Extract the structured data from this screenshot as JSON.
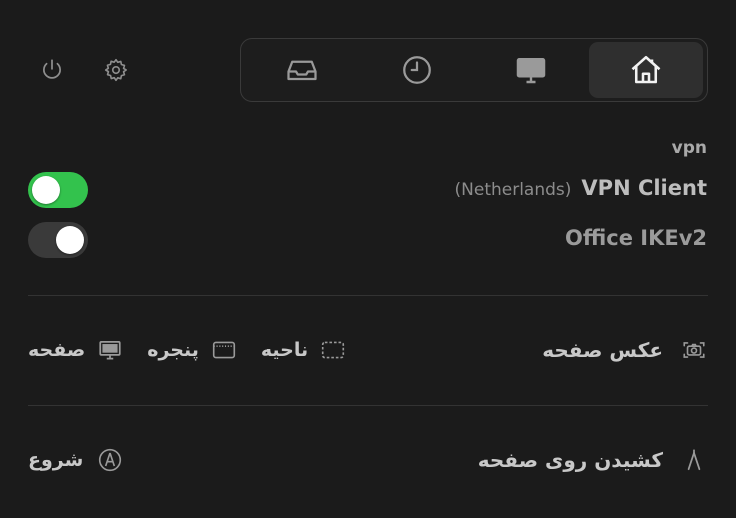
{
  "header": {
    "power_icon": "power-icon",
    "settings_icon": "gear-icon"
  },
  "tabs": [
    {
      "icon": "inbox-icon",
      "active": false
    },
    {
      "icon": "clock-icon",
      "active": false
    },
    {
      "icon": "monitor-icon",
      "active": false
    },
    {
      "icon": "home-icon",
      "active": true
    }
  ],
  "vpn": {
    "section_title": "vpn",
    "items": [
      {
        "name": "VPN Client",
        "region": "(Netherlands)",
        "enabled": true
      },
      {
        "name": "Office IKEv2",
        "region": "",
        "enabled": false
      }
    ]
  },
  "screenshot": {
    "label": "عکس صفحه",
    "options": [
      {
        "label": "ناحیه",
        "icon": "dashed-rect-icon"
      },
      {
        "label": "پنجره",
        "icon": "window-icon"
      },
      {
        "label": "صفحه",
        "icon": "monitor-icon"
      }
    ]
  },
  "draw": {
    "label": "کشیدن روی صفحه",
    "start_label": "شروع"
  },
  "colors": {
    "toggle_on": "#33c24d",
    "background": "#1b1b1b"
  }
}
